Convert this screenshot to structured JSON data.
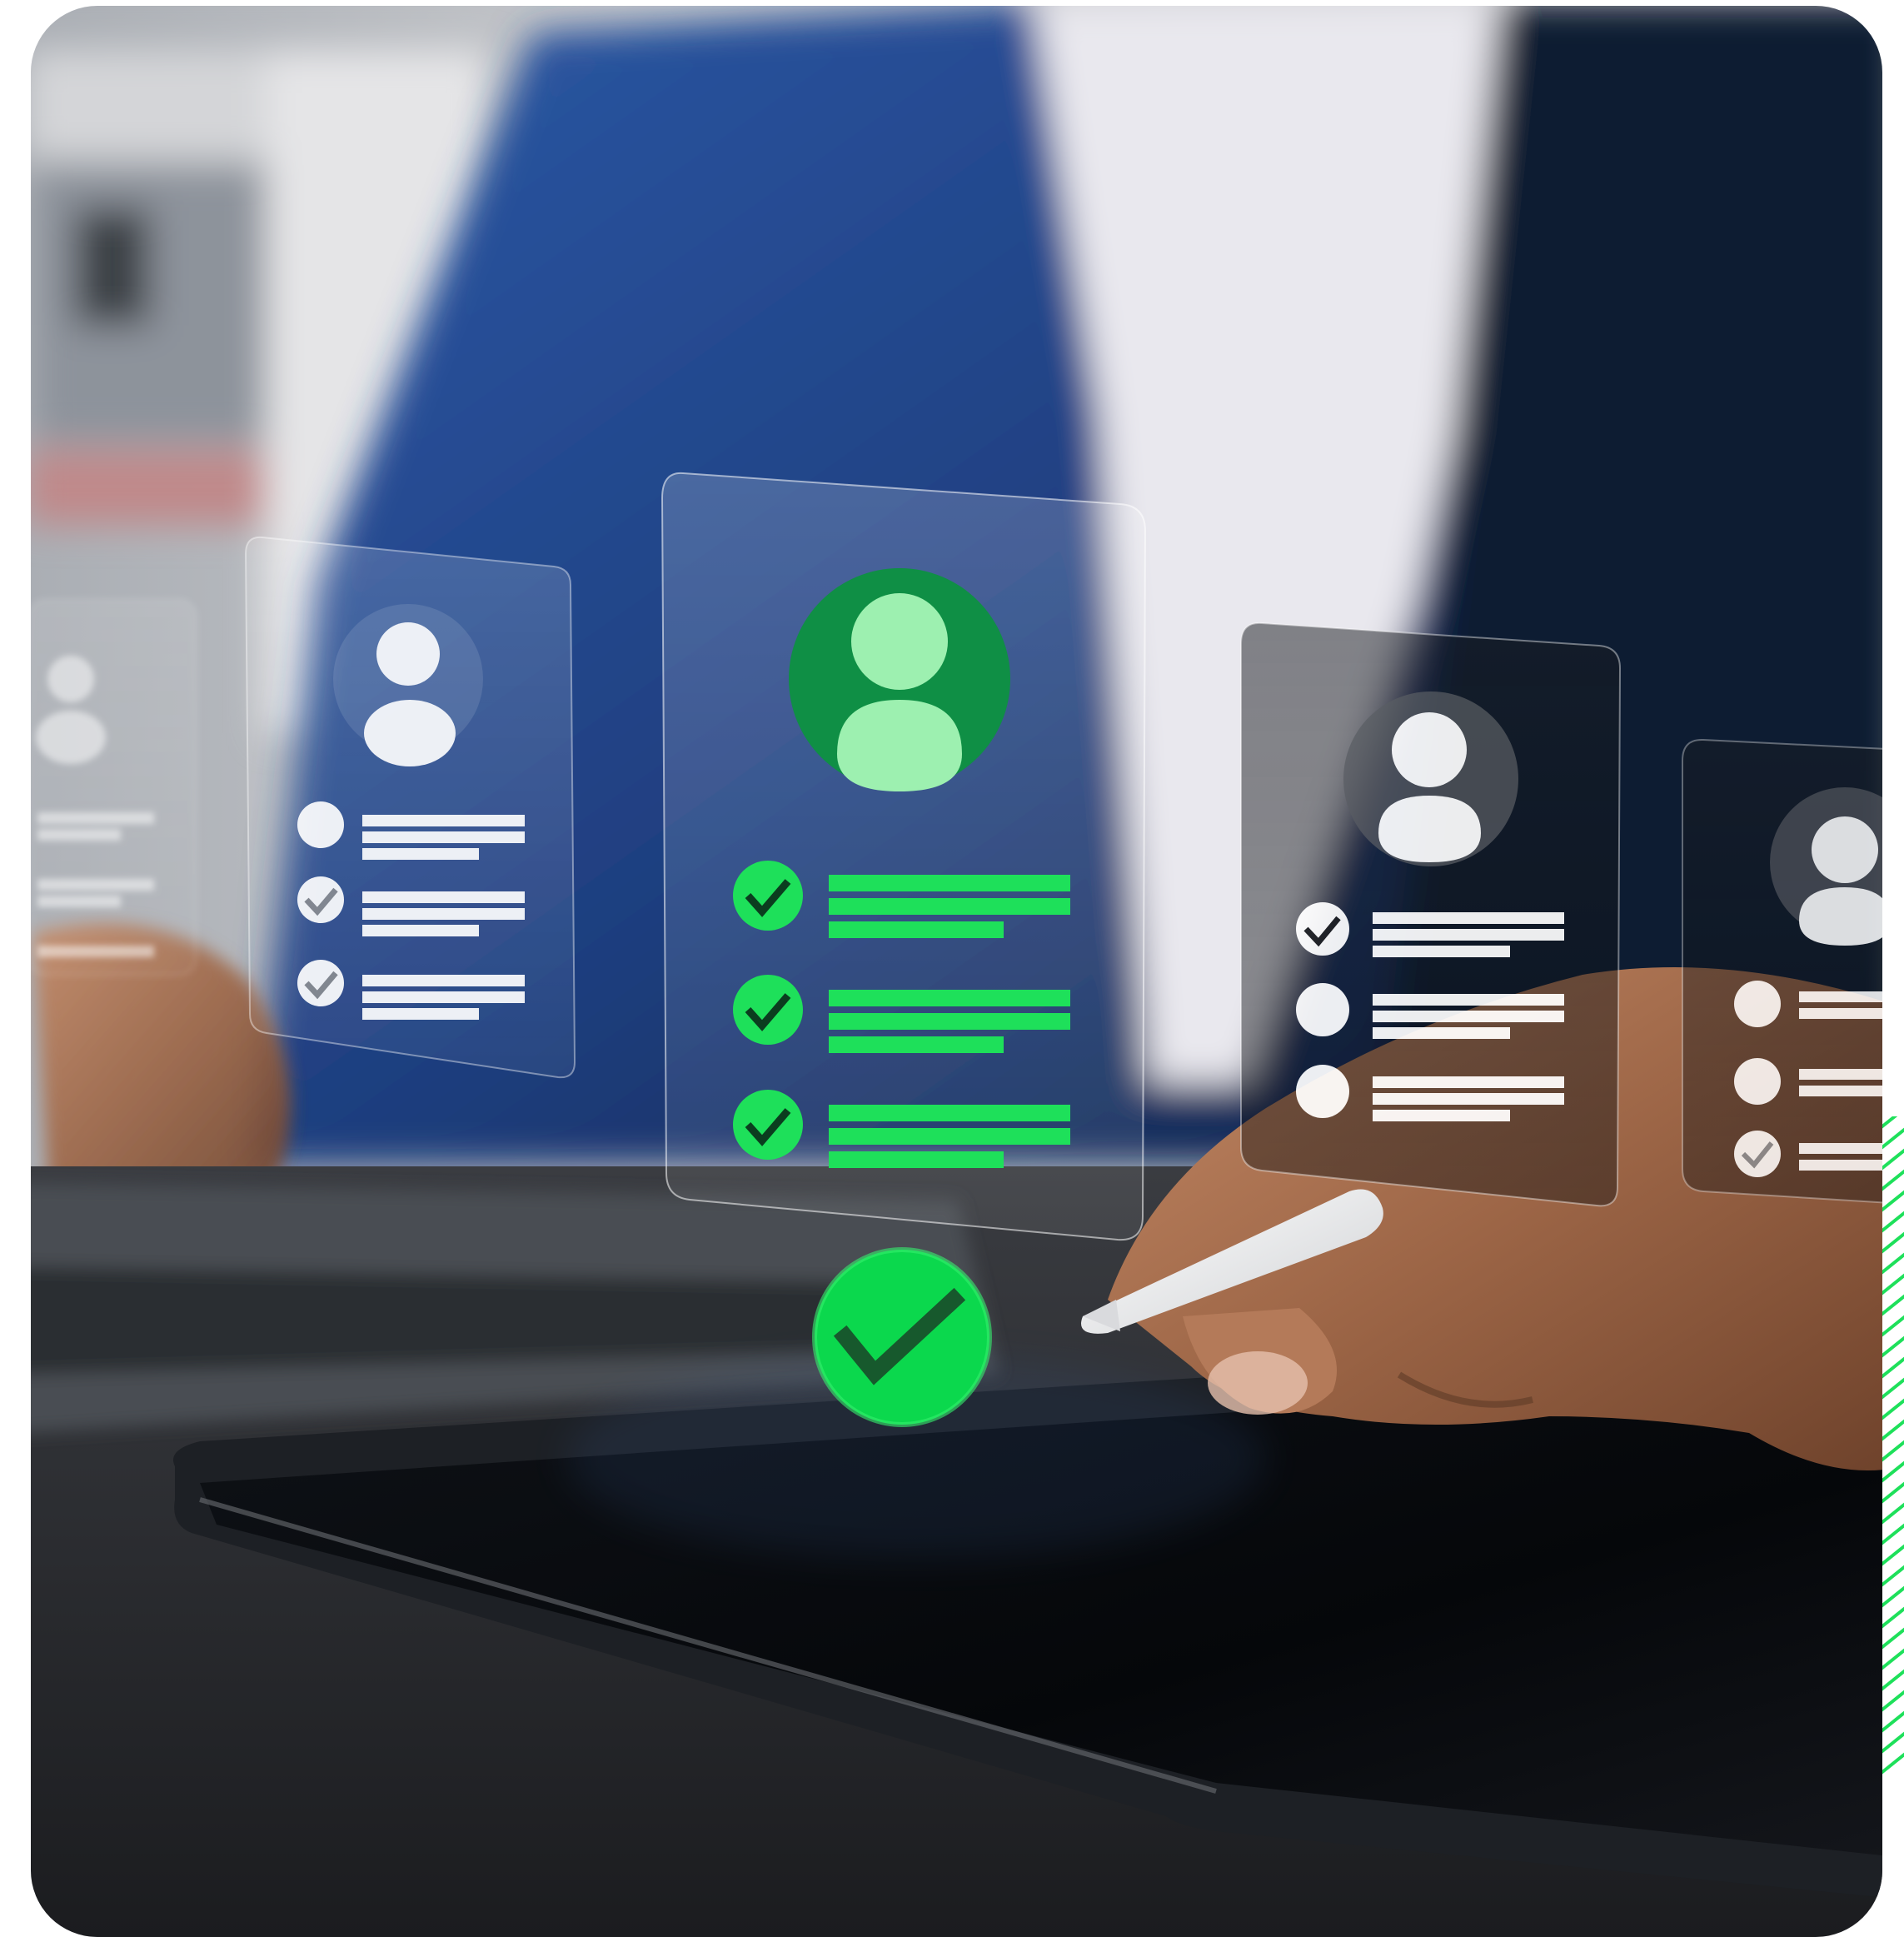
{
  "colors": {
    "accent_green": "#1ee05a",
    "deep_green": "#0f8f45",
    "light_green": "#9df0b0",
    "suit_blue": "#1f3f80",
    "shirt_white": "#e9e8ee",
    "desk_dark": "#2b2d31",
    "tablet_black": "#07090c",
    "background_gray": "#b9bcc1"
  },
  "scene": {
    "description_icons": [
      "user-profile-icon",
      "check-circle-icon",
      "approved-check-icon"
    ],
    "profiles": {
      "far_left": {
        "checked_rows": 0
      },
      "left": {
        "checked_rows": 2,
        "unchecked_rows": 1
      },
      "center_selected": {
        "checked_rows": 3
      },
      "right": {
        "checked_rows": 1,
        "unchecked_rows": 2
      },
      "far_right": {
        "checked_rows": 1,
        "unchecked_rows": 2
      }
    }
  }
}
